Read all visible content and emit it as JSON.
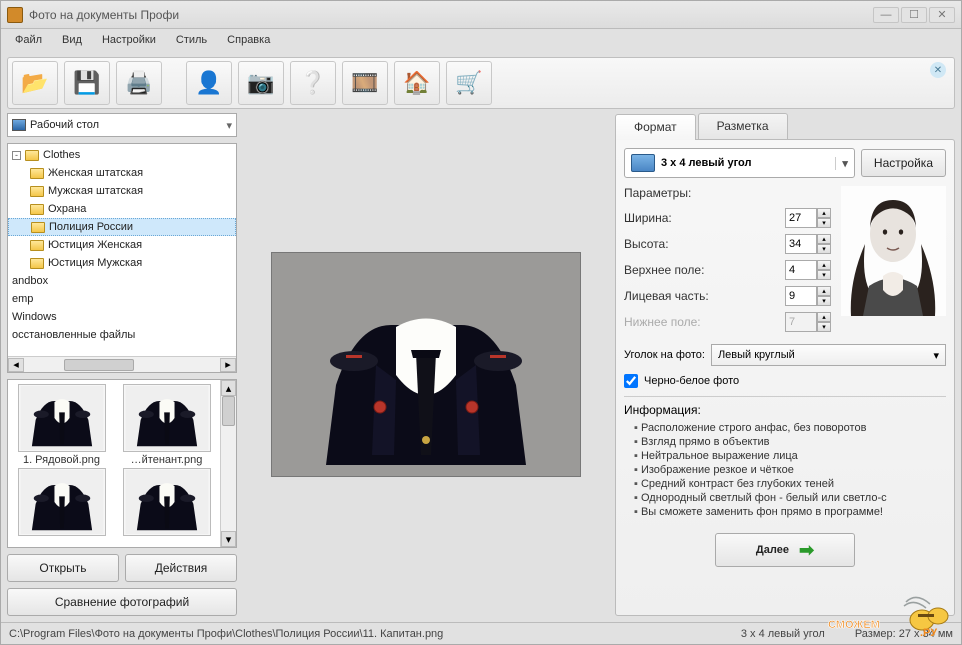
{
  "title": "Фото на документы Профи",
  "menu": [
    "Файл",
    "Вид",
    "Настройки",
    "Стиль",
    "Справка"
  ],
  "toolbar_icons": [
    "open",
    "save",
    "print",
    "person",
    "camera",
    "help",
    "film",
    "home",
    "cart"
  ],
  "root_combo": "Рабочий стол",
  "tree": [
    {
      "label": "Clothes",
      "indent": 0,
      "box": "-",
      "folder": true
    },
    {
      "label": "Женская штатская",
      "indent": 1,
      "folder": true
    },
    {
      "label": "Мужская штатская",
      "indent": 1,
      "folder": true
    },
    {
      "label": "Охрана",
      "indent": 1,
      "folder": true
    },
    {
      "label": "Полиция России",
      "indent": 1,
      "folder": true,
      "selected": true
    },
    {
      "label": "Юстиция Женская",
      "indent": 1,
      "folder": true
    },
    {
      "label": "Юстиция Мужская",
      "indent": 1,
      "folder": true
    },
    {
      "label": "andbox",
      "indent": 0
    },
    {
      "label": "emp",
      "indent": 0
    },
    {
      "label": "Windows",
      "indent": 0
    },
    {
      "label": "осстановленные файлы",
      "indent": 0
    }
  ],
  "thumbs": [
    {
      "cap": "1. Рядовой.png"
    },
    {
      "cap": "…йтенант.png"
    },
    {
      "cap": ""
    },
    {
      "cap": ""
    }
  ],
  "left_buttons": {
    "open": "Открыть",
    "actions": "Действия",
    "compare": "Сравнение фотографий"
  },
  "tabs": {
    "format": "Формат",
    "layout": "Разметка"
  },
  "format_name": "3 x 4 левый угол",
  "settings_btn": "Настройка",
  "params_title": "Параметры:",
  "params": {
    "width": {
      "label": "Ширина:",
      "value": "27"
    },
    "height": {
      "label": "Высота:",
      "value": "34"
    },
    "top": {
      "label": "Верхнее поле:",
      "value": "4"
    },
    "face": {
      "label": "Лицевая часть:",
      "value": "9"
    },
    "bottom": {
      "label": "Нижнее поле:",
      "value": "7"
    }
  },
  "corner": {
    "label": "Уголок на фото:",
    "value": "Левый круглый"
  },
  "bw": {
    "label": "Черно-белое фото",
    "checked": true
  },
  "info_title": "Информация:",
  "info": [
    "Расположение строго анфас, без поворотов",
    "Взгляд прямо в объектив",
    "Нейтральное выражение лица",
    "Изображение резкое и чёткое",
    "Средний контраст без глубоких теней",
    "Однородный светлый фон - белый или светло-с",
    "Вы сможете заменить фон прямо в программе!"
  ],
  "next": "Далее",
  "status": {
    "path": "C:\\Program Files\\Фото на документы Профи\\Clothes\\Полиция России\\11. Капитан.png",
    "format": "3 x 4 левый угол",
    "size": "Размер: 27 x 34 мм"
  }
}
